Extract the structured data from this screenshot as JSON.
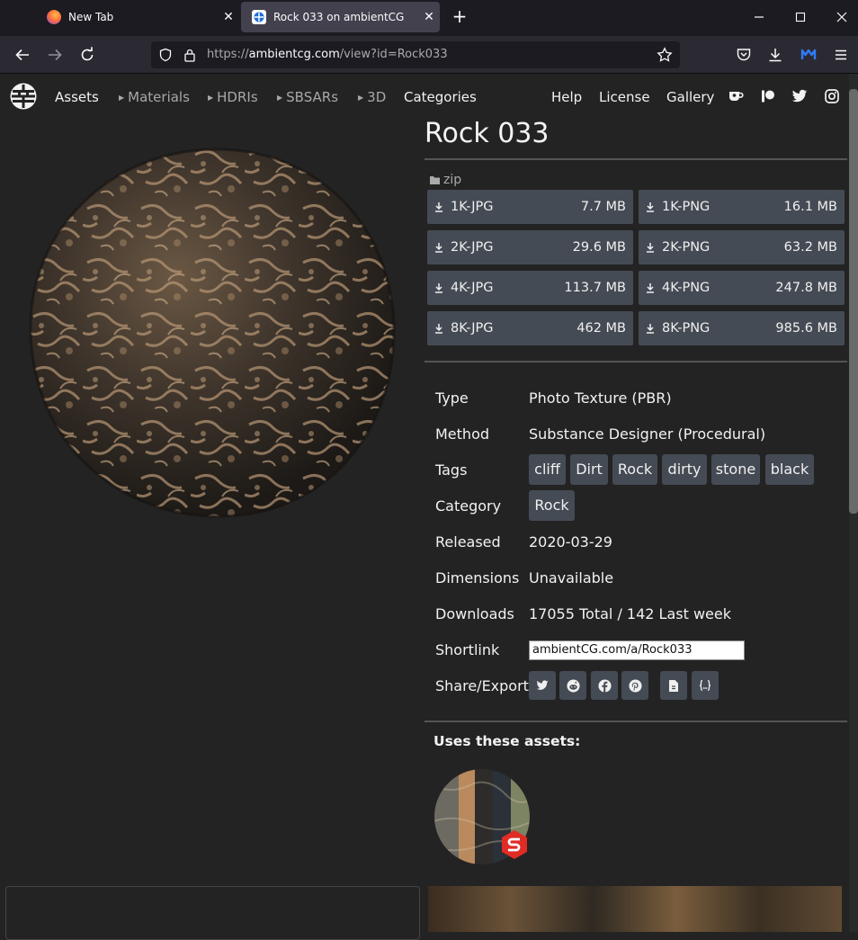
{
  "browser": {
    "tabs": [
      {
        "title": "New Tab"
      },
      {
        "title": "Rock 033 on ambientCG"
      }
    ],
    "url_prefix": "https://",
    "url_host": "ambientcg.com",
    "url_path": "/view?id=Rock033",
    "close_glyph": "✕",
    "newtab_glyph": "+"
  },
  "sitenav": {
    "assets": "Assets",
    "materials": "Materials",
    "hdris": "HDRIs",
    "sbsars": "SBSARs",
    "threed": "3D",
    "categories": "Categories",
    "help": "Help",
    "license": "License",
    "gallery": "Gallery"
  },
  "asset": {
    "title": "Rock 033",
    "zip_label": "zip",
    "downloads": [
      {
        "label": "1K-JPG",
        "size": "7.7 MB"
      },
      {
        "label": "1K-PNG",
        "size": "16.1 MB"
      },
      {
        "label": "2K-JPG",
        "size": "29.6 MB"
      },
      {
        "label": "2K-PNG",
        "size": "63.2 MB"
      },
      {
        "label": "4K-JPG",
        "size": "113.7 MB"
      },
      {
        "label": "4K-PNG",
        "size": "247.8 MB"
      },
      {
        "label": "8K-JPG",
        "size": "462 MB"
      },
      {
        "label": "8K-PNG",
        "size": "985.6 MB"
      }
    ],
    "details": {
      "type_label": "Type",
      "type_value": "Photo Texture (PBR)",
      "method_label": "Method",
      "method_value": "Substance Designer (Procedural)",
      "tags_label": "Tags",
      "tags": [
        "cliff",
        "Dirt",
        "Rock",
        "dirty",
        "stone",
        "black"
      ],
      "category_label": "Category",
      "category_value": "Rock",
      "released_label": "Released",
      "released_value": "2020-03-29",
      "dimensions_label": "Dimensions",
      "dimensions_value": "Unavailable",
      "downloads_label": "Downloads",
      "downloads_value": "17055 Total / 142 Last week",
      "shortlink_label": "Shortlink",
      "shortlink_value": "ambientCG.com/a/Rock033",
      "share_label": "Share/Export"
    },
    "uses_heading": "Uses these assets:"
  }
}
